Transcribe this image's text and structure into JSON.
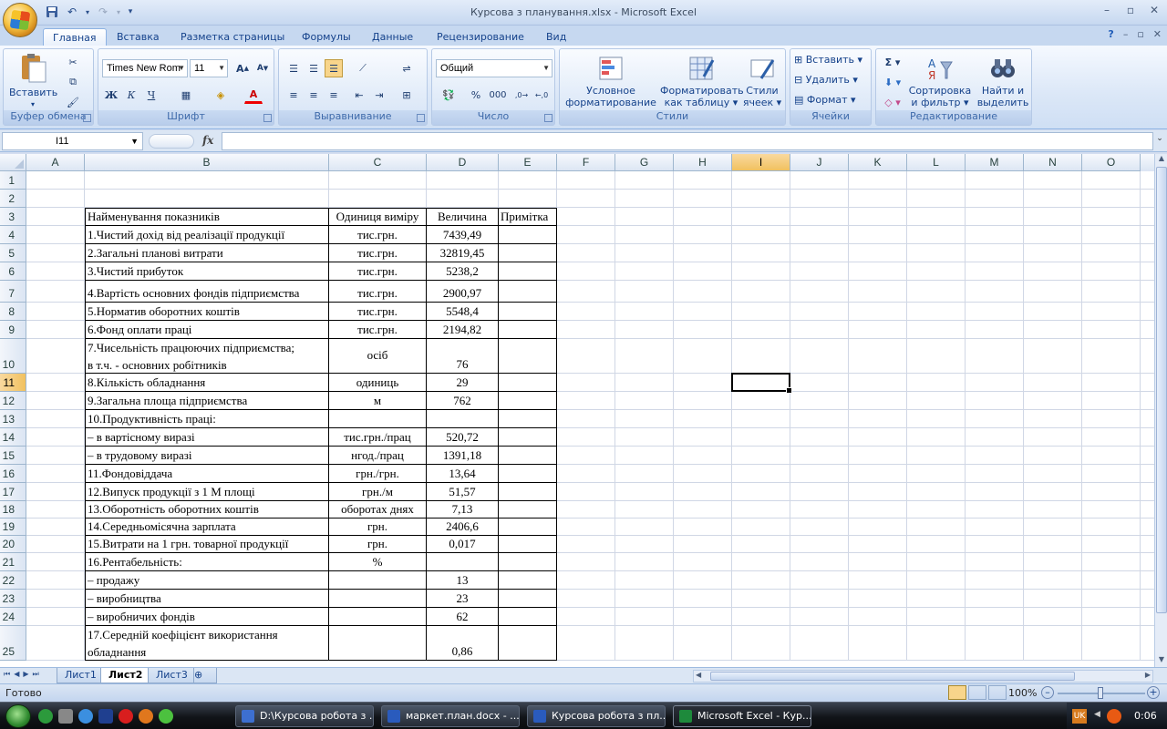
{
  "window": {
    "title": "Курсова з планування.xlsx - Microsoft Excel"
  },
  "ribbon_tabs": [
    "Главная",
    "Вставка",
    "Разметка страницы",
    "Формулы",
    "Данные",
    "Рецензирование",
    "Вид"
  ],
  "ribbon": {
    "clipboard": {
      "label": "Буфер обмена",
      "paste": "Вставить"
    },
    "font": {
      "label": "Шрифт",
      "font_name": "Times New Rom",
      "font_size": "11",
      "bold": "Ж",
      "italic": "К",
      "underline": "Ч"
    },
    "alignment": {
      "label": "Выравнивание"
    },
    "number": {
      "label": "Число",
      "format": "Общий"
    },
    "styles": {
      "label": "Стили",
      "conditional_1": "Условное",
      "conditional_2": "форматирование",
      "as_table_1": "Форматировать",
      "as_table_2": "как таблицу",
      "cell_styles_1": "Стили",
      "cell_styles_2": "ячеек"
    },
    "cells": {
      "label": "Ячейки",
      "insert": "Вставить",
      "delete": "Удалить",
      "format": "Формат"
    },
    "editing": {
      "label": "Редактирование",
      "sort_1": "Сортировка",
      "sort_2": "и фильтр",
      "find_1": "Найти и",
      "find_2": "выделить"
    }
  },
  "formula_bar": {
    "name_box": "I11",
    "fx": "fx",
    "content": ""
  },
  "columns": [
    "A",
    "B",
    "C",
    "D",
    "E",
    "F",
    "G",
    "H",
    "I",
    "J",
    "K",
    "L",
    "M",
    "N",
    "O"
  ],
  "rows": [
    {
      "n": "1"
    },
    {
      "n": "2"
    },
    {
      "n": "3",
      "b": "Найменування показників",
      "c": "Одиниця виміру",
      "d": "Величина",
      "e": "Примітка"
    },
    {
      "n": "4",
      "b": "1.Чистий дохід від реалізації продукції",
      "c": "тис.грн.",
      "d": "7439,49"
    },
    {
      "n": "5",
      "b": "2.Загальні планові витрати",
      "c": "тис.грн.",
      "d": "32819,45"
    },
    {
      "n": "6",
      "b": "3.Чистий прибуток",
      "c": "тис.грн.",
      "d": "5238,2"
    },
    {
      "n": "7",
      "b": "4.Вартість основних фондів підприємства",
      "c": "тис.грн.",
      "d": "2900,97"
    },
    {
      "n": "8",
      "b": "5.Норматив оборотних коштів",
      "c": "тис.грн.",
      "d": "5548,4"
    },
    {
      "n": "9",
      "b": "6.Фонд  оплати праці",
      "c": "тис.грн.",
      "d": "2194,82"
    },
    {
      "n": "10",
      "b": "7.Чисельність  працюючих  підприємства;",
      "b2": "в т.ч. - основних робітників",
      "c": "осіб",
      "d": "76"
    },
    {
      "n": "11",
      "b": "8.Кількість обладнання",
      "c": "одиниць",
      "d": "29"
    },
    {
      "n": "12",
      "b": "9.Загальна площа підприємства",
      "c": "м",
      "d": "762"
    },
    {
      "n": "13",
      "b": "10.Продуктивність праці:"
    },
    {
      "n": "14",
      "b": "– в вартісному виразі",
      "c": "тис.грн./прац",
      "d": "520,72"
    },
    {
      "n": "15",
      "b": "– в трудовому виразі",
      "c": "нгод./прац",
      "d": "1391,18"
    },
    {
      "n": "16",
      "b": "11.Фондовіддача",
      "c": "грн./грн.",
      "d": "13,64"
    },
    {
      "n": "17",
      "b": "12.Випуск продукції з 1 М площі",
      "c": "грн./м",
      "d": "51,57"
    },
    {
      "n": "18",
      "b": "13.Оборотність оборотних коштів",
      "c": "оборотах днях",
      "d": "7,13"
    },
    {
      "n": "19",
      "b": "14.Середньомісячна зарплата",
      "c": "грн.",
      "d": "2406,6"
    },
    {
      "n": "20",
      "b": "15.Витрати на 1 грн. товарної продукції",
      "c": "грн.",
      "d": "0,017"
    },
    {
      "n": "21",
      "b": "16.Рентабельність:",
      "c": "%"
    },
    {
      "n": "22",
      "b": "– продажу",
      "d": "13"
    },
    {
      "n": "23",
      "b": "– виробництва",
      "d": "23"
    },
    {
      "n": "24",
      "b": "– виробничих фондів",
      "d": "62"
    },
    {
      "n": "25",
      "b": "17.Середній  коефіцієнт  використання",
      "b2": "обладнання",
      "d": "0,86"
    }
  ],
  "sheets": [
    "Лист1",
    "Лист2",
    "Лист3"
  ],
  "active_sheet": "Лист2",
  "status": {
    "ready": "Готово",
    "zoom": "100%"
  },
  "taskbar": {
    "items": [
      "D:\\Курсова робота з ...",
      "маркет.план.docx - ...",
      "Курсова робота з пл...",
      "Microsoft Excel - Кур..."
    ],
    "lang": "UK",
    "clock": "0:06"
  }
}
